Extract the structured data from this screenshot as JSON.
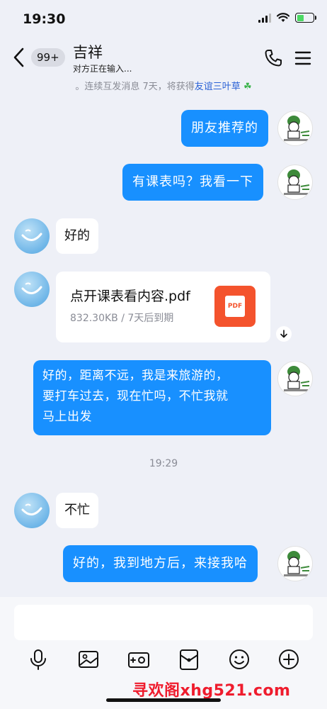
{
  "status_bar": {
    "time": "19:30",
    "battery_level": 0.45
  },
  "header": {
    "unread_count": "99+",
    "contact_name": "吉祥",
    "typing_status": "对方正在输入..."
  },
  "hint": {
    "prefix": "。连续互发消息 7天，将获得",
    "link": "友谊三叶草",
    "icon": "☘"
  },
  "messages": [
    {
      "from": "self",
      "text": "朋友推荐的"
    },
    {
      "from": "self",
      "text": "有课表吗？我看一下"
    },
    {
      "from": "other",
      "text": "好的"
    },
    {
      "from": "other",
      "type": "file",
      "file_name": "点开课表看内容.pdf",
      "file_meta": "832.30KB / 7天后到期",
      "file_icon_label": "PDF"
    },
    {
      "from": "self",
      "text_line1": "好的，距离不远，我是来旅游的，",
      "text_line2": "要打车过去，现在忙吗，不忙我就",
      "text_line3": "马上出发"
    },
    {
      "from": "other",
      "text": "不忙"
    },
    {
      "from": "self",
      "text": "好的，我到地方后，来接我哈"
    }
  ],
  "timestamp": "19:29",
  "toolbar": [
    "mic-icon",
    "image-icon",
    "camera-icon",
    "red-packet-icon",
    "emoji-icon",
    "plus-icon"
  ],
  "watermark": "寻欢阁xhg521.com",
  "colors": {
    "self_bubble": "#1890ff",
    "background": "#eef0f7",
    "pdf": "#f4532d",
    "link": "#2b62d6"
  }
}
